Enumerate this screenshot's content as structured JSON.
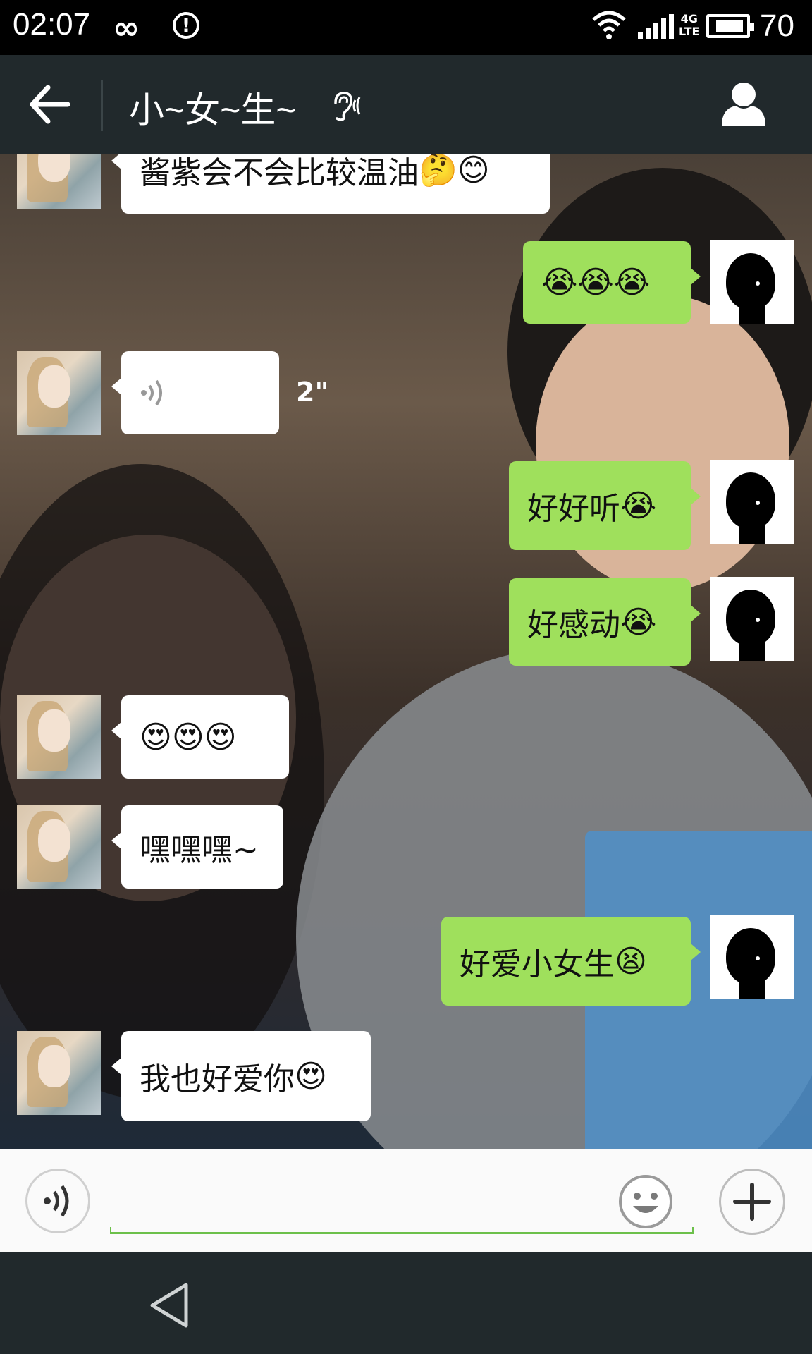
{
  "status_bar": {
    "time": "02:07",
    "infinity_glyph": "∞",
    "alert_glyph": "!",
    "network": "4G",
    "network_sub": "LTE",
    "battery": "70"
  },
  "header": {
    "back_icon": "arrow-left-icon",
    "title": "小~女~生~",
    "mode_icon": "ear-icon",
    "profile_icon": "person-icon"
  },
  "messages": [
    {
      "side": "left",
      "text": "酱紫会不会比较温油",
      "emoji": "🤔😊"
    },
    {
      "side": "right",
      "text": "",
      "emoji": "😭😭😭"
    },
    {
      "side": "left",
      "type": "voice",
      "duration": "2\""
    },
    {
      "side": "right",
      "text": "好好听",
      "emoji": "😭"
    },
    {
      "side": "right",
      "text": "好感动",
      "emoji": "😭"
    },
    {
      "side": "left",
      "text": "",
      "emoji": "😍😍😍"
    },
    {
      "side": "left",
      "text": "嘿嘿嘿~",
      "emoji": ""
    },
    {
      "side": "right",
      "text": "好爱小女生",
      "emoji": "😫"
    },
    {
      "side": "left",
      "text": "我也好爱你",
      "emoji": "😍"
    }
  ],
  "input_bar": {
    "voice_icon": "voice-icon",
    "emoji_icon": "smiley-icon",
    "more_icon": "plus-icon",
    "placeholder": ""
  },
  "nav_bar": {
    "back_icon": "triangle-back-icon"
  }
}
